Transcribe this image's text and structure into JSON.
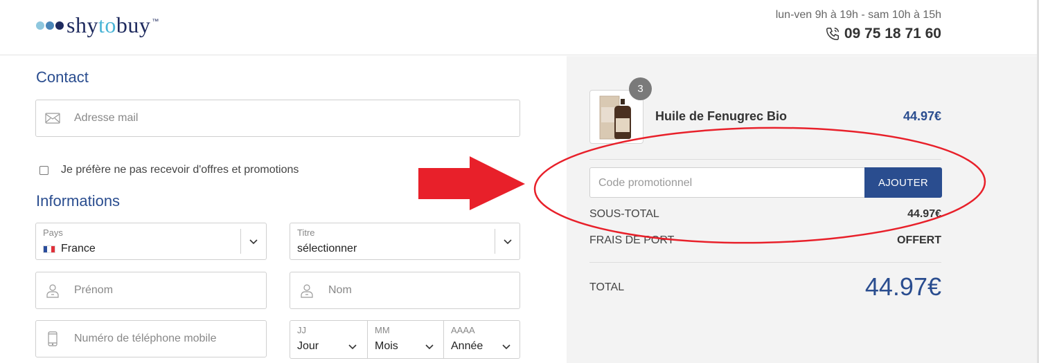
{
  "header": {
    "logo_prefix": "shy",
    "logo_mid": "to",
    "logo_suffix": "buy",
    "logo_tm": "™",
    "hours": "lun-ven 9h à 19h - sam 10h à 15h",
    "phone": "09 75 18 71 60"
  },
  "contact": {
    "title": "Contact",
    "email_placeholder": "Adresse mail",
    "optout_label": "Je préfère ne pas recevoir d'offres et promotions",
    "optout_checked": false
  },
  "informations": {
    "title": "Informations",
    "country": {
      "label": "Pays",
      "value": "France"
    },
    "civility": {
      "label": "Titre",
      "value": "sélectionner"
    },
    "firstname_placeholder": "Prénom",
    "lastname_placeholder": "Nom",
    "phone_placeholder": "Numéro de téléphone mobile",
    "birthdate": {
      "day": {
        "label": "JJ",
        "value": "Jour"
      },
      "month": {
        "label": "MM",
        "value": "Mois"
      },
      "year": {
        "label": "AAAA",
        "value": "Année"
      }
    }
  },
  "summary": {
    "product": {
      "name": "Huile de Fenugrec Bio",
      "price": "44.97€",
      "quantity": "3"
    },
    "promo_placeholder": "Code promotionnel",
    "promo_button": "AJOUTER",
    "subtotal_label": "SOUS-TOTAL",
    "subtotal_value": "44.97€",
    "shipping_label": "FRAIS DE PORT",
    "shipping_value": "OFFERT",
    "total_label": "TOTAL",
    "total_value": "44.97€"
  },
  "colors": {
    "brand_blue": "#2a4d8f",
    "annotation_red": "#e8202a",
    "panel_bg": "#f3f3f3"
  }
}
